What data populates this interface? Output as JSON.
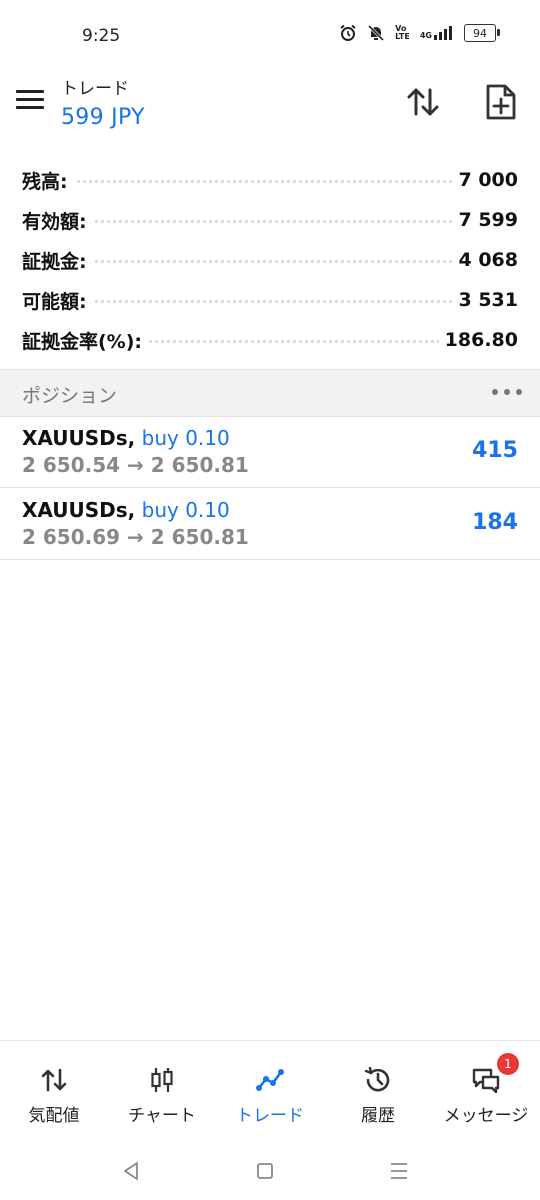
{
  "status_bar": {
    "time": "9:25",
    "network_top": "Vo",
    "network_bottom": "LTE",
    "signal": "4G",
    "battery": "94"
  },
  "header": {
    "title": "トレード",
    "subtitle": "599 JPY"
  },
  "account": [
    {
      "label": "残高:",
      "value": "7 000"
    },
    {
      "label": "有効額:",
      "value": "7 599"
    },
    {
      "label": "証拠金:",
      "value": "4 068"
    },
    {
      "label": "可能額:",
      "value": "3 531"
    },
    {
      "label": "証拠金率(%):",
      "value": "186.80"
    }
  ],
  "positions_section": {
    "title": "ポジション"
  },
  "positions": [
    {
      "symbol": "XAUUSDs,",
      "side": "buy 0.10",
      "prices": "2 650.54 → 2 650.81",
      "profit": "415"
    },
    {
      "symbol": "XAUUSDs,",
      "side": "buy 0.10",
      "prices": "2 650.69 → 2 650.81",
      "profit": "184"
    }
  ],
  "bottom_nav": [
    {
      "label": "気配値",
      "icon": "quotes-icon"
    },
    {
      "label": "チャート",
      "icon": "chart-icon"
    },
    {
      "label": "トレード",
      "icon": "trade-icon",
      "active": true
    },
    {
      "label": "履歴",
      "icon": "history-icon"
    },
    {
      "label": "メッセージ",
      "icon": "messages-icon",
      "badge": "1"
    }
  ],
  "colors": {
    "accent": "#1a73e8",
    "badge": "#e53935"
  }
}
